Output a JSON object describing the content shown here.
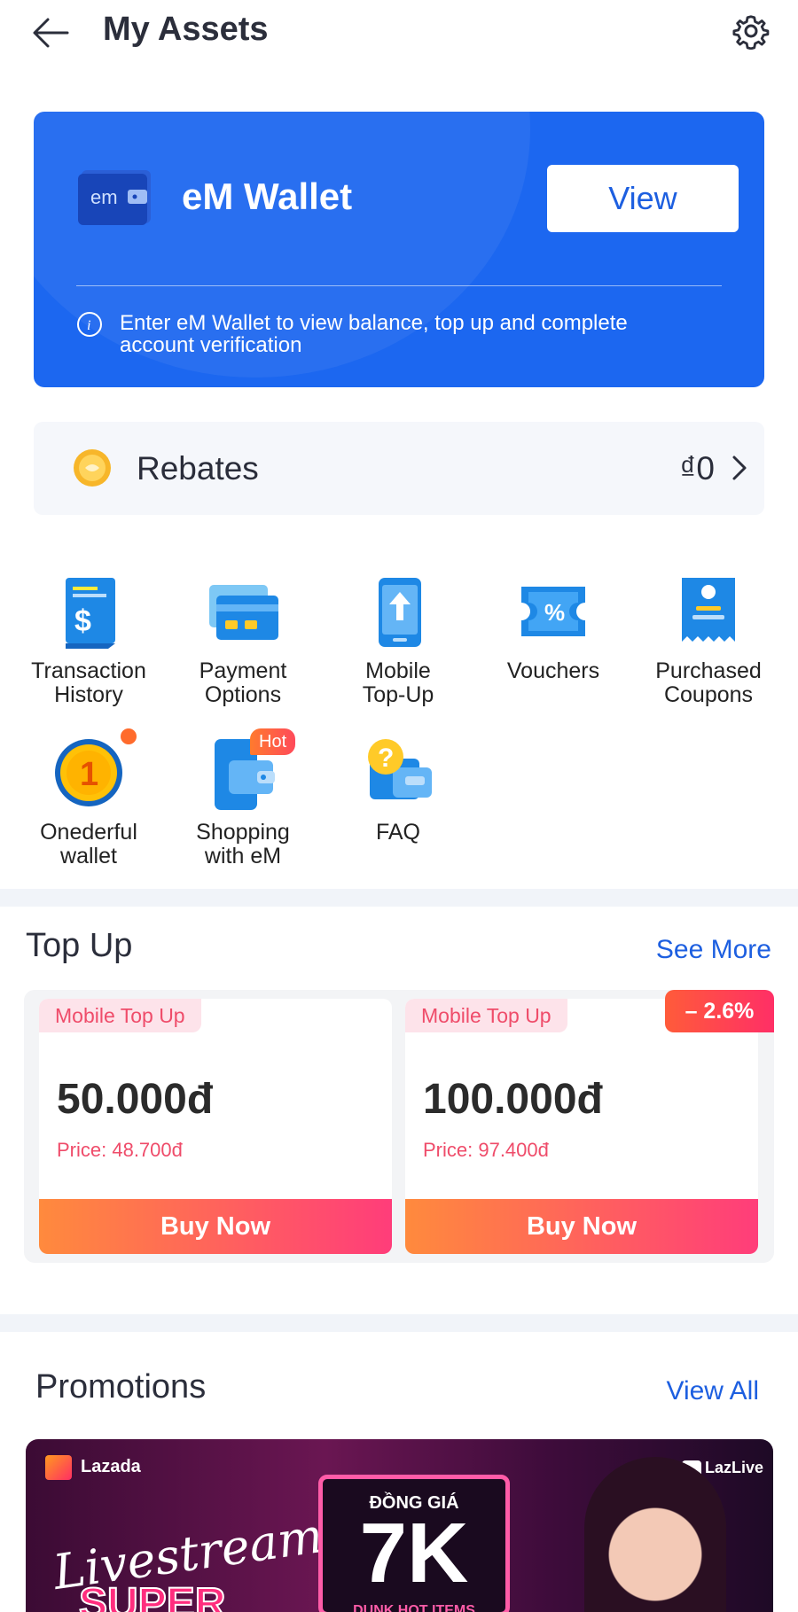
{
  "header": {
    "title": "My Assets"
  },
  "wallet": {
    "logo_text": "em",
    "title": "eM Wallet",
    "view_label": "View",
    "note": "Enter eM Wallet to view balance, top up and complete account verification"
  },
  "rebates": {
    "label": "Rebates",
    "value": "₫0"
  },
  "grid": [
    {
      "label_1": "Transaction",
      "label_2": "History",
      "icon": "receipt-dollar-icon"
    },
    {
      "label_1": "Payment",
      "label_2": "Options",
      "icon": "card-icon"
    },
    {
      "label_1": "Mobile",
      "label_2": "Top-Up",
      "icon": "phone-topup-icon"
    },
    {
      "label_1": "Vouchers",
      "label_2": "",
      "icon": "voucher-icon"
    },
    {
      "label_1": "Purchased",
      "label_2": "Coupons",
      "icon": "coupon-icon"
    },
    {
      "label_1": "Onederful",
      "label_2": "wallet",
      "icon": "coin-one-icon",
      "badge_text": "1"
    },
    {
      "label_1": "Shopping",
      "label_2": "with eM",
      "icon": "phone-wallet-icon",
      "badge": "Hot"
    },
    {
      "label_1": "FAQ",
      "label_2": "",
      "icon": "faq-icon",
      "badge_text": "?"
    }
  ],
  "topup": {
    "title": "Top Up",
    "see_more": "See More",
    "discount": "– 2.6%",
    "cards": [
      {
        "tag": "Mobile Top Up",
        "amount": "50.000đ",
        "price": "Price: 48.700đ",
        "buy_label": "Buy Now"
      },
      {
        "tag": "Mobile Top Up",
        "amount": "100.000đ",
        "price": "Price: 97.400đ",
        "buy_label": "Buy Now"
      }
    ]
  },
  "promotions": {
    "title": "Promotions",
    "view_all": "View All",
    "banner": {
      "brand": "Lazada",
      "badge": "LazLive",
      "script_text": "Livestream",
      "big_text": "SUPER",
      "headline_top": "ĐỒNG GIÁ",
      "headline_main": "7K",
      "headline_sub": "DUNK HOT ITEMS"
    }
  },
  "colors": {
    "primary": "#1c67f0",
    "link": "#1d5fe0",
    "accent": "#ff3d7a",
    "orange": "#ff8a3d"
  }
}
